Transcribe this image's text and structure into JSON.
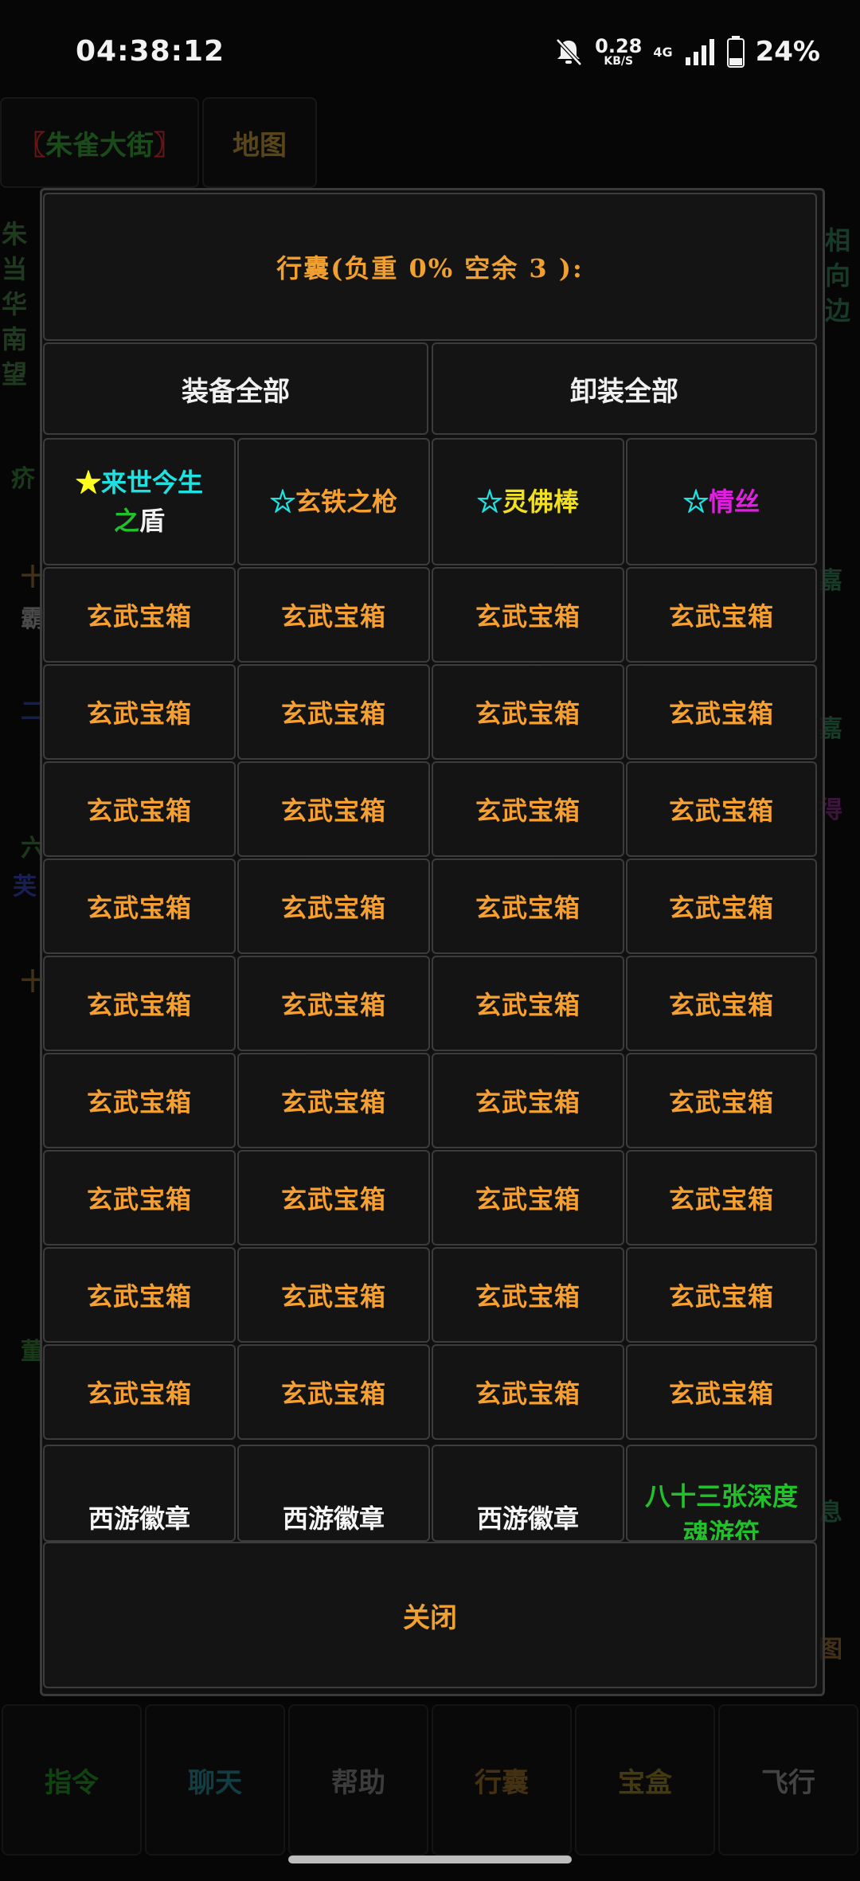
{
  "status": {
    "time": "04:38:12",
    "net_speed": "0.28",
    "net_unit": "KB/S",
    "net_type": "4G",
    "battery": "24%"
  },
  "background": {
    "location_open": "〖",
    "location_name": "朱雀大街",
    "location_close": "〗",
    "map_tab": "地图",
    "left_edge": "朱当华南望",
    "left_items": [
      "疥",
      "十",
      "霸",
      "二",
      "六",
      "芙",
      "十",
      "董"
    ],
    "right_edge": "相向边",
    "right_items": [
      "嘉",
      "嘉",
      "得",
      "息",
      "图"
    ],
    "nav": [
      {
        "label": "指令",
        "color": "#1f7a22"
      },
      {
        "label": "聊天",
        "color": "#1f6f7a"
      },
      {
        "label": "帮助",
        "color": "#6e6e6e"
      },
      {
        "label": "行囊",
        "color": "#7a5a1f"
      },
      {
        "label": "宝盒",
        "color": "#7a6a1f"
      },
      {
        "label": "飞行",
        "color": "#7a7a7a"
      }
    ]
  },
  "dialog": {
    "title": "行囊(负重 0% 空余 3 ):",
    "equip_all": "装备全部",
    "unequip_all": "卸装全部",
    "equipped": [
      {
        "star": "★",
        "parts": [
          {
            "text": "来世今生",
            "color": "#20e0e0"
          },
          {
            "text": "之",
            "color": "#22c02a"
          },
          {
            "text": "盾",
            "color": "#f0f0f0"
          }
        ]
      },
      {
        "star": "☆",
        "parts": [
          {
            "text": "玄铁之枪",
            "color": "#f5a030"
          }
        ]
      },
      {
        "star": "☆",
        "parts": [
          {
            "text": "灵佛棒",
            "color": "#f0e020"
          }
        ]
      },
      {
        "star": "☆",
        "parts": [
          {
            "text": "情丝",
            "color": "#e020e0"
          }
        ]
      }
    ],
    "box_label": "玄武宝箱",
    "badge_label": "西游徽章",
    "green_item": "八十三张深度魂游符",
    "close": "关闭"
  }
}
